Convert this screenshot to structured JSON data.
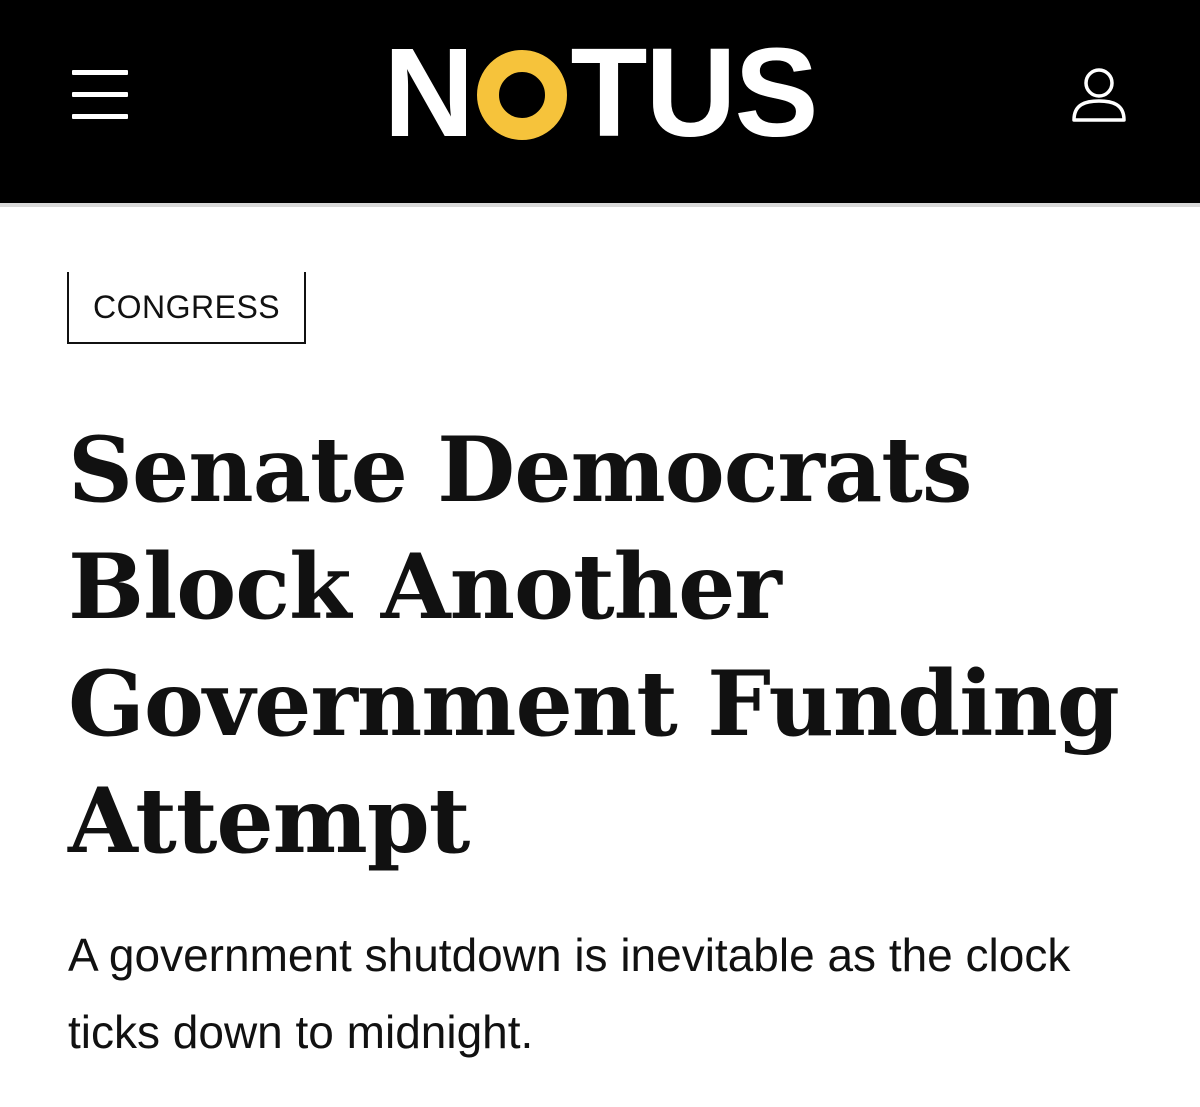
{
  "header": {
    "logo_text_before": "N",
    "logo_text_accent": "O",
    "logo_text_after": "TUS",
    "logo_accent_color": "#f6c33b",
    "background_color": "#000000",
    "menu_icon": "hamburger-menu-icon",
    "account_icon": "user-account-icon"
  },
  "article": {
    "category": "CONGRESS",
    "headline": "Senate Democrats Block Another Government Funding Attempt",
    "dek": "A government shutdown is inevitable as the clock ticks down to midnight."
  }
}
